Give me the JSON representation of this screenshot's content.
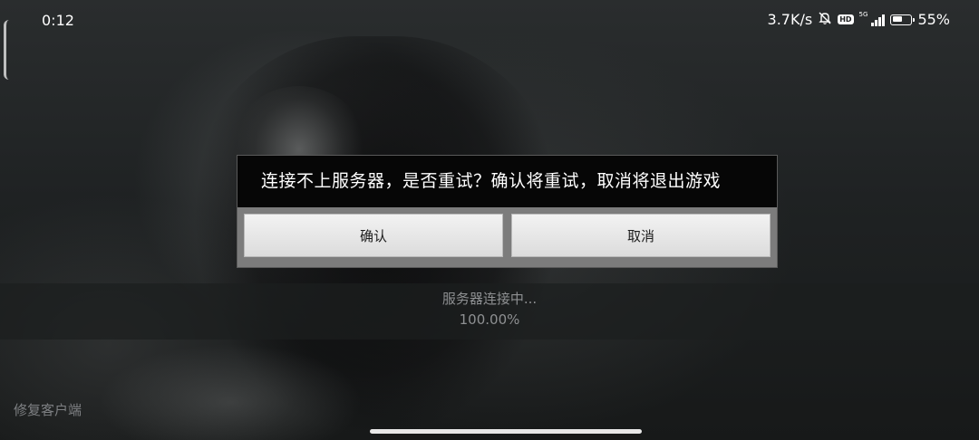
{
  "status_bar": {
    "time": "0:12",
    "network_speed": "3.7K/s",
    "battery_percent": "55%",
    "battery_level": 0.55,
    "hd_badge": "HD",
    "network_type": "5G",
    "icons": [
      "mute-icon",
      "hd-icon",
      "signal-icon",
      "battery-icon"
    ]
  },
  "dialog": {
    "message": "连接不上服务器，是否重试？确认将重试，取消将退出游戏",
    "confirm_label": "确认",
    "cancel_label": "取消"
  },
  "loading": {
    "status_text": "服务器连接中...",
    "progress_text": "100.00%",
    "progress": 1.0
  },
  "footer": {
    "repair_label": "修复客户端"
  },
  "colors": {
    "dialog_header": "#060606",
    "dialog_body": "#7c7c7c",
    "button_face": "#e8e8e8",
    "loading_text": "#8e9092"
  }
}
